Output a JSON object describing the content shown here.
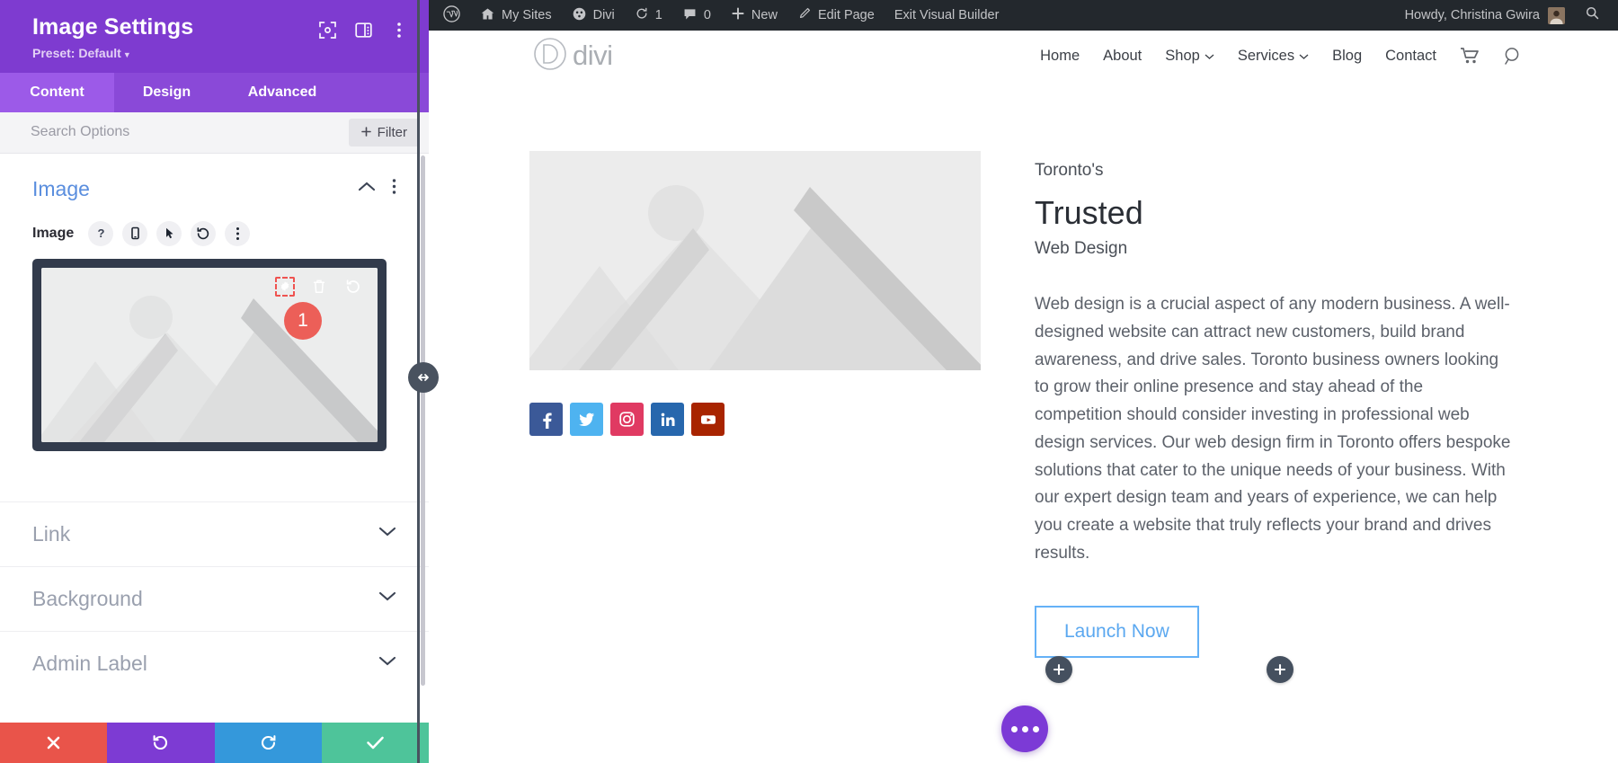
{
  "panel": {
    "title": "Image Settings",
    "preset_label": "Preset: Default",
    "header_icons": [
      {
        "name": "fullscreen-icon"
      },
      {
        "name": "layout-toggle-icon"
      },
      {
        "name": "more-options-icon"
      }
    ],
    "tabs": [
      {
        "label": "Content",
        "active": true
      },
      {
        "label": "Design",
        "active": false
      },
      {
        "label": "Advanced",
        "active": false
      }
    ],
    "search": {
      "placeholder": "Search Options",
      "value": ""
    },
    "filter_label": "Filter",
    "open_section": {
      "title": "Image",
      "field_label": "Image",
      "field_icons": [
        "help-icon",
        "responsive-icon",
        "hover-icon",
        "reset-icon",
        "more-icon"
      ],
      "preview_overlay_icons": [
        "settings-gear-icon",
        "trash-icon",
        "reset-icon"
      ],
      "preview_badge": "1"
    },
    "closed_sections": [
      {
        "label": "Link"
      },
      {
        "label": "Background"
      },
      {
        "label": "Admin Label"
      }
    ],
    "footer_buttons": [
      {
        "name": "cancel-button",
        "glyph": "✖",
        "color": "#e9544a"
      },
      {
        "name": "undo-button",
        "glyph": "↺",
        "color": "#7d3bd3"
      },
      {
        "name": "redo-button",
        "glyph": "↻",
        "color": "#3498db"
      },
      {
        "name": "save-button",
        "glyph": "✔",
        "color": "#4ec49a"
      }
    ]
  },
  "adminbar": {
    "items": [
      {
        "label": "",
        "icon": "wordpress-logo-icon"
      },
      {
        "label": "My Sites",
        "icon": "sites-icon"
      },
      {
        "label": "Divi",
        "icon": "divi-icon"
      },
      {
        "label": "1",
        "icon": "updates-icon"
      },
      {
        "label": "0",
        "icon": "comments-icon"
      },
      {
        "label": "New",
        "icon": "plus-icon"
      },
      {
        "label": "Edit Page",
        "icon": "pencil-icon"
      },
      {
        "label": "Exit Visual Builder",
        "icon": ""
      }
    ],
    "howdy": "Howdy, Christina Gwira",
    "search_icon": "search-icon"
  },
  "site": {
    "logo_text": "divi",
    "nav": [
      {
        "label": "Home",
        "dropdown": false
      },
      {
        "label": "About",
        "dropdown": false
      },
      {
        "label": "Shop",
        "dropdown": true
      },
      {
        "label": "Services",
        "dropdown": true
      },
      {
        "label": "Blog",
        "dropdown": false
      },
      {
        "label": "Contact",
        "dropdown": false
      }
    ],
    "nav_icons": [
      "cart-icon",
      "search-icon"
    ],
    "socials": [
      {
        "name": "facebook-icon",
        "color": "#3b5998"
      },
      {
        "name": "twitter-icon",
        "color": "#4eb3f0"
      },
      {
        "name": "instagram-icon",
        "color": "#e03a62"
      },
      {
        "name": "linkedin-icon",
        "color": "#2767ad"
      },
      {
        "name": "youtube-icon",
        "color": "#a82400"
      }
    ],
    "heading_top": "Toronto's",
    "heading_main": "Trusted",
    "heading_sub": "Web Design",
    "body": "Web design is a crucial aspect of any modern business. A well-designed website can attract new customers, build brand awareness, and drive sales. Toronto business owners looking to grow their online presence and stay ahead of the competition should consider investing in professional web design services. Our web design firm in Toronto offers bespoke solutions that cater to the unique needs of your business. With our expert design team and years of experience, we can help you create a website that truly reflects your brand and drives results.",
    "cta_label": "Launch Now",
    "add_buttons": [
      "add-module-button",
      "add-module-button"
    ],
    "fab": "page-settings-button"
  },
  "colors": {
    "panel_purple": "#7e3bd0",
    "tab_purple": "#8a49d8",
    "accent_blue": "#5a8ede",
    "badge_red": "#ec5f58",
    "adminbar_dark": "#23282d"
  }
}
